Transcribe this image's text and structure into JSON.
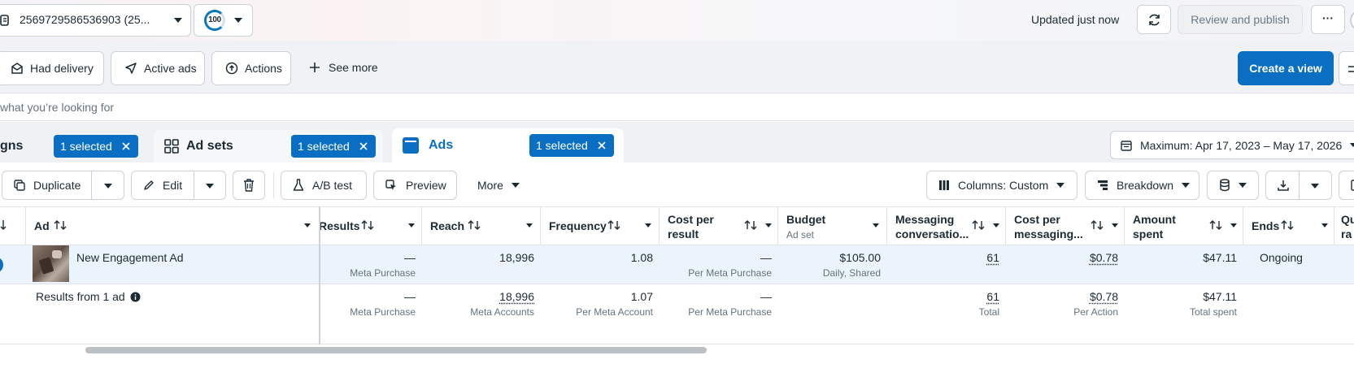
{
  "topbar": {
    "account_label": "2569729586536903 (25...",
    "score": "100",
    "updated_text": "Updated just now",
    "review_publish_label": "Review and publish",
    "more_label": "···"
  },
  "filters": {
    "chips": [
      "Had delivery",
      "Active ads",
      "Actions"
    ],
    "see_more": "See more",
    "create_view": "Create a view"
  },
  "search": {
    "placeholder": "what you’re looking for"
  },
  "tabs": [
    {
      "label": "gns",
      "selected": "1 selected"
    },
    {
      "label": "Ad sets",
      "selected": "1 selected"
    },
    {
      "label": "Ads",
      "selected": "1 selected"
    }
  ],
  "date_range": "Maximum: Apr 17, 2023 – May 17, 2026",
  "toolbar": {
    "duplicate": "Duplicate",
    "edit": "Edit",
    "ab_test": "A/B test",
    "preview": "Preview",
    "more": "More",
    "columns": "Columns: Custom",
    "breakdown": "Breakdown"
  },
  "table": {
    "headers": {
      "ad": "Ad",
      "results": "Results",
      "reach": "Reach",
      "frequency": "Frequency",
      "cost_per_result_1": "Cost per",
      "cost_per_result_2": "result",
      "budget": "Budget",
      "budget_sub": "Ad set",
      "messaging_1": "Messaging",
      "messaging_2": "conversatio...",
      "cost_msg_1": "Cost per",
      "cost_msg_2": "messaging...",
      "amount_1": "Amount",
      "amount_2": "spent",
      "ends": "Ends",
      "quality_1": "Qu",
      "quality_2": "ra"
    },
    "row": {
      "ad_name": "New Engagement Ad",
      "results": "—",
      "results_sub": "Meta Purchase",
      "reach": "18,996",
      "frequency": "1.08",
      "cost_per_result": "—",
      "cost_per_result_sub": "Per Meta Purchase",
      "budget": "$105.00",
      "budget_sub": "Daily, Shared",
      "messaging": "61",
      "cost_msg": "$0.78",
      "amount": "$47.11",
      "ends": "Ongoing"
    },
    "totals": {
      "label": "Results from 1 ad",
      "results": "—",
      "results_sub": "Meta Purchase",
      "reach": "18,996",
      "reach_sub": "Meta Accounts",
      "frequency": "1.07",
      "frequency_sub": "Per Meta Account",
      "cost_per_result": "—",
      "cost_per_result_sub": "Per Meta Purchase",
      "messaging": "61",
      "messaging_sub": "Total",
      "cost_msg": "$0.78",
      "cost_msg_sub": "Per Action",
      "amount": "$47.11",
      "amount_sub": "Total spent"
    }
  },
  "colors": {
    "accent": "#0a6fc2",
    "row_selected": "#ebf3fc"
  }
}
